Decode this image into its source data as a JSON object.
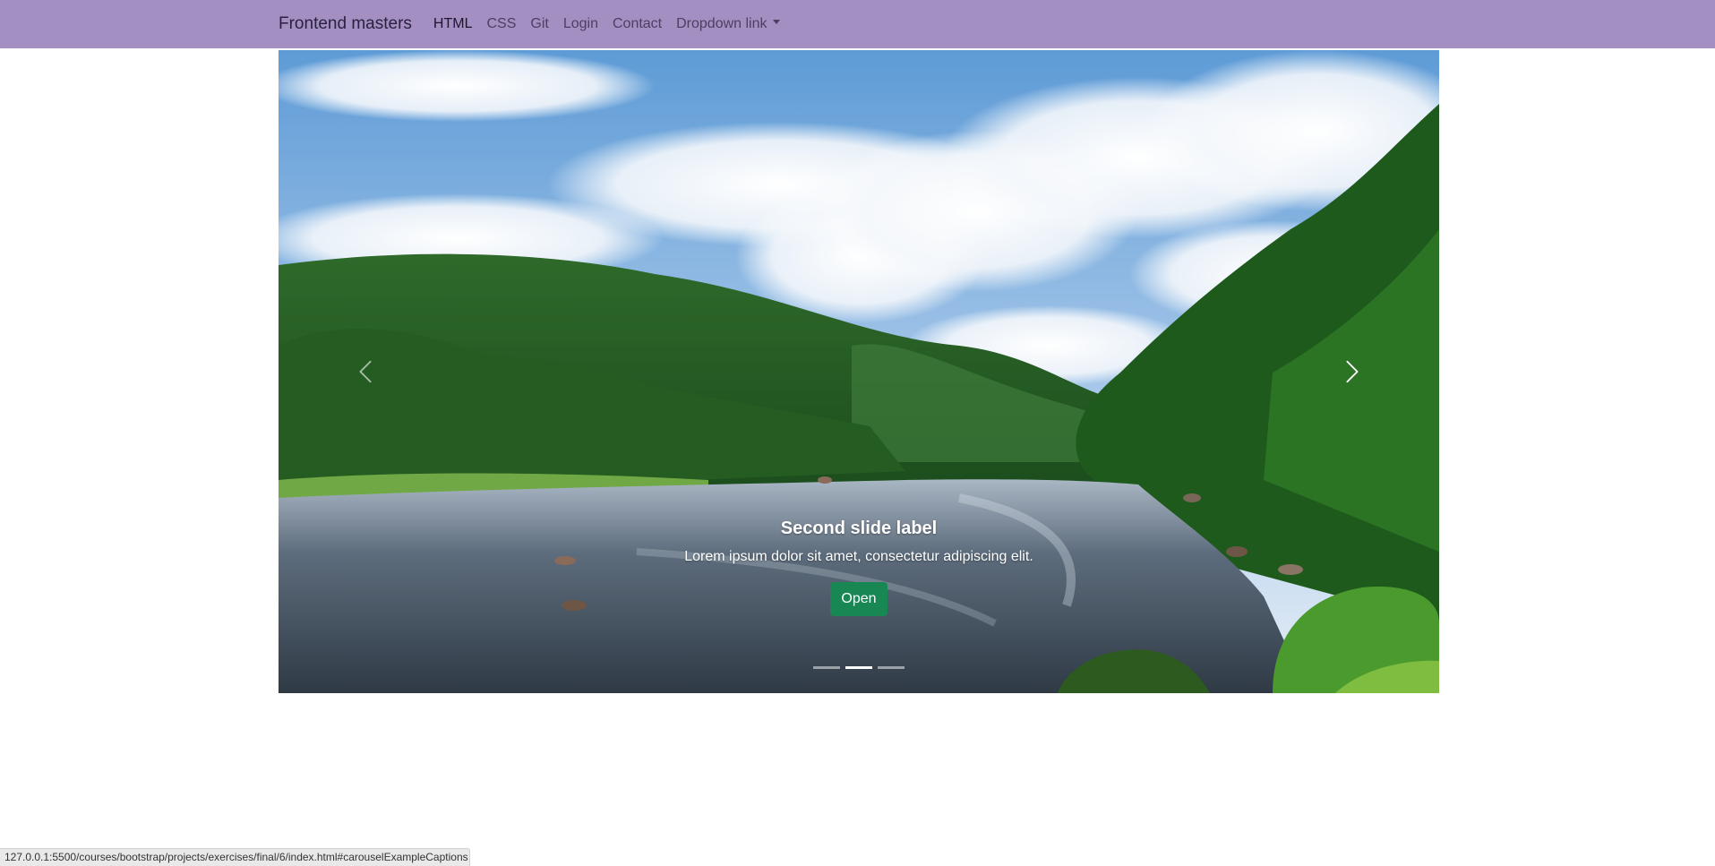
{
  "navbar": {
    "brand": "Frontend masters",
    "links": [
      {
        "label": "HTML",
        "active": true
      },
      {
        "label": "CSS",
        "active": false
      },
      {
        "label": "Git",
        "active": false
      },
      {
        "label": "Login",
        "active": false
      },
      {
        "label": "Contact",
        "active": false
      }
    ],
    "dropdown": {
      "label": "Dropdown link"
    }
  },
  "carousel": {
    "caption": {
      "title": "Second slide label",
      "text": "Lorem ipsum dolor sit amet, consectetur adipiscing elit.",
      "button_label": "Open"
    },
    "indicator_count": 3,
    "active_index": 1,
    "prev_icon": "chevron-left-icon",
    "next_icon": "chevron-right-icon"
  },
  "status_bar": {
    "url": "127.0.0.1:5500/courses/bootstrap/projects/exercises/final/6/index.html#carouselExampleCaptions"
  },
  "colors": {
    "navbar_bg": "#a48fc2",
    "button_bg": "#198754"
  }
}
